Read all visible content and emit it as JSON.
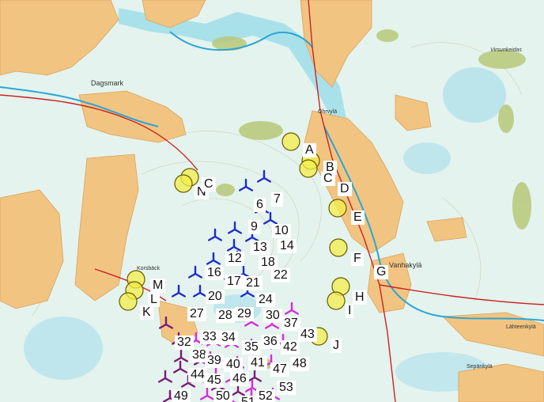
{
  "colors": {
    "background": "#e4f3ee",
    "field": "#f2c482",
    "field_edge": "#d9a359",
    "water": "#7fd6e8",
    "bog": "#b7c878",
    "viewpoint_fill": "#f3ee4a",
    "viewpoint_stroke": "#6a5a00",
    "turbine_blue": "#1f2ccc",
    "turbine_purple": "#7a1a78",
    "turbine_magenta": "#d72bd6",
    "road": "#cc2222"
  },
  "viewpoint_labels": [
    {
      "id": "A",
      "text": "A"
    },
    {
      "id": "B",
      "text": "B"
    },
    {
      "id": "C",
      "text": "C"
    },
    {
      "id": "D",
      "text": "D"
    },
    {
      "id": "E",
      "text": "E"
    },
    {
      "id": "F",
      "text": "F"
    },
    {
      "id": "G",
      "text": "G"
    },
    {
      "id": "H",
      "text": "H"
    },
    {
      "id": "I",
      "text": "I"
    },
    {
      "id": "J",
      "text": "J"
    },
    {
      "id": "K",
      "text": "K"
    },
    {
      "id": "L",
      "text": "L"
    },
    {
      "id": "M",
      "text": "M"
    },
    {
      "id": "N",
      "text": "N"
    },
    {
      "id": "O",
      "text": "C"
    }
  ],
  "turbine_numbers": [
    "6",
    "7",
    "9",
    "10",
    "12",
    "13",
    "14",
    "16",
    "17",
    "18",
    "20",
    "21",
    "22",
    "24",
    "27",
    "28",
    "29",
    "30",
    "33",
    "34",
    "35",
    "36",
    "37",
    "38",
    "39",
    "40",
    "41",
    "42",
    "43",
    "44",
    "45",
    "46",
    "47",
    "48",
    "49",
    "50",
    "51",
    "52",
    "53",
    "32"
  ],
  "place_names": [
    {
      "id": "dagsmark",
      "text": "Dagsmark"
    },
    {
      "id": "ohrvyla",
      "text": "Ohrvylä"
    },
    {
      "id": "vanhakyla",
      "text": "Vanhakylä"
    },
    {
      "id": "korsback",
      "text": "Korsbäck"
    },
    {
      "id": "lahteenkyla",
      "text": "Lähteenkylä"
    },
    {
      "id": "virsunkeidas",
      "text": "Virsunkeidas"
    },
    {
      "id": "sepankyla",
      "text": "Sepänkylä"
    }
  ]
}
